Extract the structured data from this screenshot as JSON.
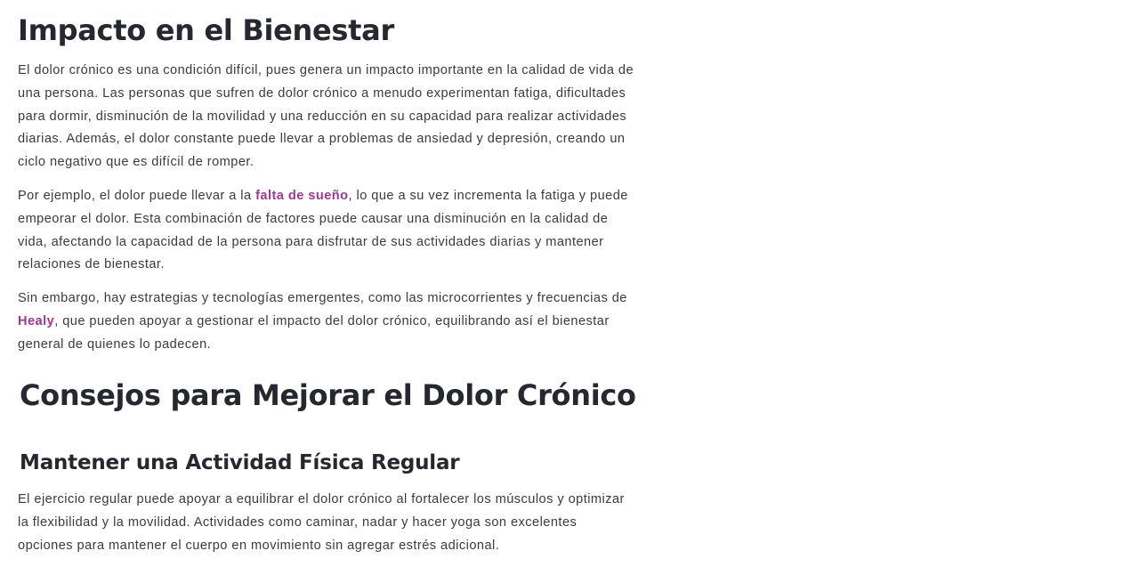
{
  "article": {
    "section1": {
      "heading": "Impacto en el Bienestar",
      "p1": {
        "line1": "El dolor crónico es una condición difícil, pues genera un impacto importante en la calidad de vida de",
        "line2": "una persona. Las personas que sufren de dolor crónico a menudo experimentan fatiga, dificultades",
        "line3": "para dormir, disminución de la movilidad y una reducción en su capacidad para realizar actividades",
        "line4": "diarias. Además, el dolor constante puede llevar a problemas de ansiedad y depresión, creando un",
        "line5": "ciclo negativo que es difícil de romper."
      },
      "p2": {
        "before": "Por ejemplo, el dolor puede llevar a la ",
        "link": "falta de sueño",
        "after1": ", lo que a su vez incrementa la fatiga y puede",
        "line2": "empeorar el dolor. Esta combinación de factores puede causar una disminución en la calidad de",
        "line3": "vida, afectando la capacidad de la persona para disfrutar de sus actividades diarias y mantener",
        "line4": "relaciones de bienestar."
      },
      "p3": {
        "line1": "Sin embargo, hay estrategias y tecnologías emergentes, como las microcorrientes y frecuencias de",
        "link": "Healy",
        "after2": ", que pueden apoyar a gestionar el impacto del dolor crónico, equilibrando así el bienestar",
        "line3": "general de quienes lo padecen."
      }
    },
    "section2": {
      "heading": "Consejos para Mejorar el Dolor Crónico",
      "subheading": "Mantener una Actividad Física Regular",
      "p4": {
        "line1": "El ejercicio regular puede apoyar a equilibrar el dolor crónico al fortalecer los músculos y optimizar",
        "line2": "la flexibilidad y la movilidad. Actividades como caminar, nadar y hacer yoga son excelentes",
        "line3": "opciones para mantener el cuerpo en movimiento sin agregar estrés adicional."
      }
    }
  },
  "colors": {
    "heading": "#252830",
    "body_text": "#3b3b3b",
    "link": "#a0359a",
    "background": "#ffffff"
  }
}
